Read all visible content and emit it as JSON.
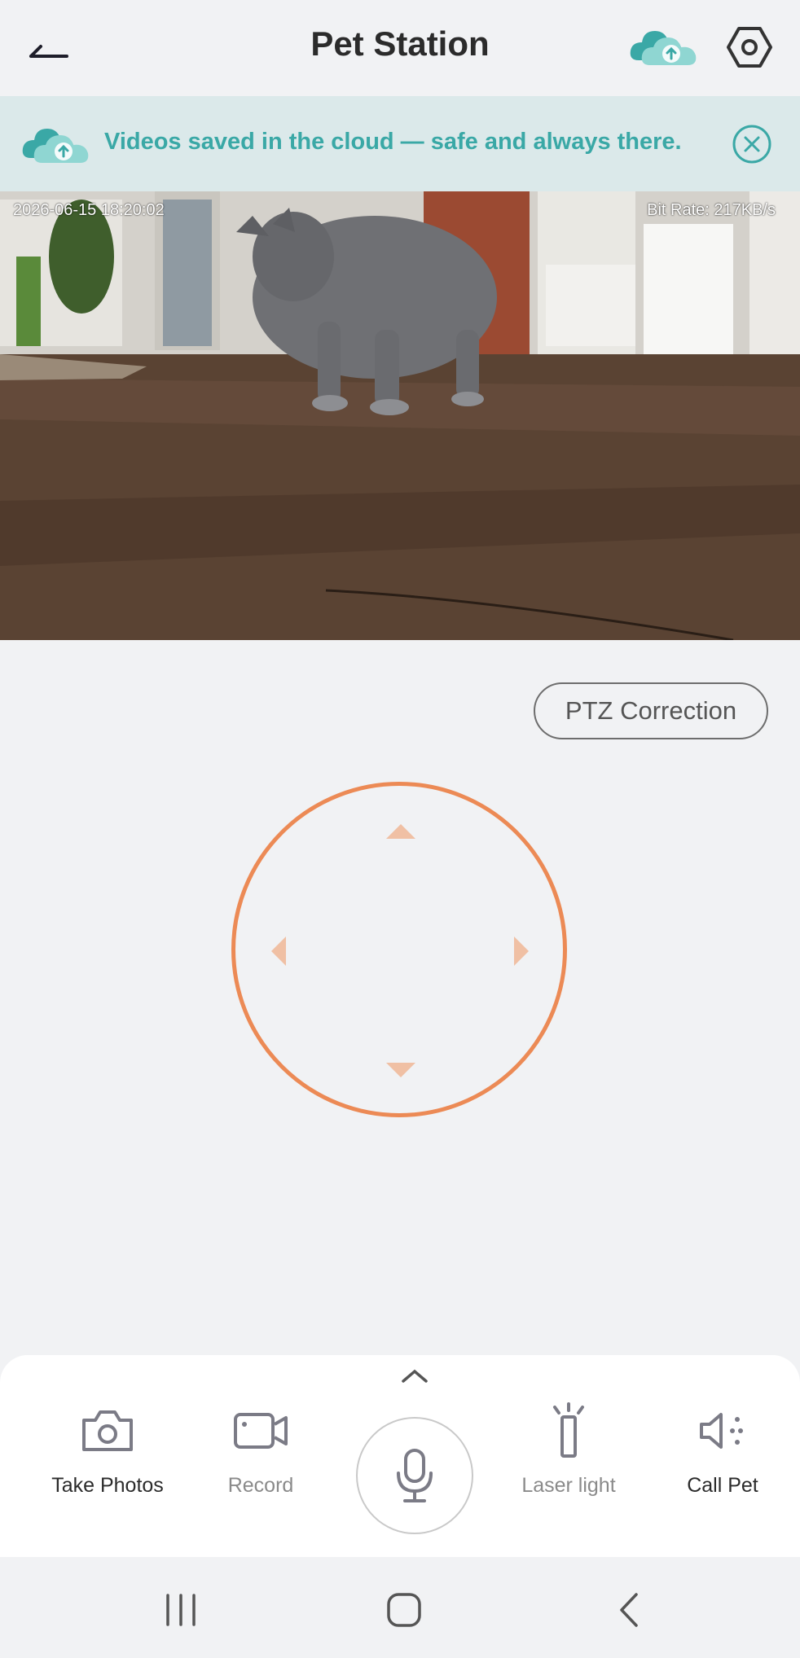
{
  "header": {
    "title": "Pet Station"
  },
  "banner": {
    "text": "Videos saved in the cloud — safe and always there."
  },
  "video": {
    "timestamp": "2026-06-15 18:20:02",
    "bitrate": "Bit Rate: 217KB/s"
  },
  "ptz": {
    "correction_label": "PTZ Correction"
  },
  "toolbar": {
    "take_photos_label": "Take Photos",
    "record_label": "Record",
    "laser_light_label": "Laser light",
    "call_pet_label": "Call Pet"
  },
  "colors": {
    "accent_orange": "#ec8a55",
    "teal": "#3aa8a6",
    "banner_bg": "#dbe9ea",
    "background": "#f1f2f4"
  },
  "icons": [
    "back-arrow-icon",
    "cloud-upload-icon",
    "settings-hexagon-icon",
    "close-circle-icon",
    "camera-icon",
    "video-camera-icon",
    "microphone-icon",
    "laser-icon",
    "speaker-icon",
    "chevron-up-icon"
  ]
}
